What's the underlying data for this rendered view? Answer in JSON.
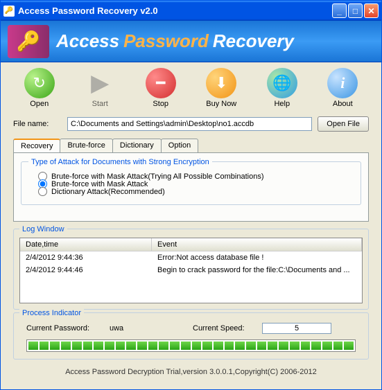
{
  "title": "Access Password Recovery v2.0",
  "banner": {
    "word1": "Access",
    "word2": "Password",
    "word3": "Recovery"
  },
  "toolbar": {
    "open": "Open",
    "start": "Start",
    "stop": "Stop",
    "buy": "Buy Now",
    "help": "Help",
    "about": "About"
  },
  "file": {
    "label": "File name:",
    "value": "C:\\Documents and Settings\\admin\\Desktop\\no1.accdb",
    "open_btn": "Open File"
  },
  "tabs": {
    "recovery": "Recovery",
    "brute": "Brute-force",
    "dict": "Dictionary",
    "option": "Option"
  },
  "attack": {
    "title": "Type of Attack for Documents with Strong Encryption",
    "opt1": "Brute-force with Mask Attack(Trying All Possible Combinations)",
    "opt2": "Brute-force with Mask Attack",
    "opt3": "Dictionary Attack(Recommended)"
  },
  "log": {
    "title": "Log Window",
    "col_date": "Date,time",
    "col_event": "Event",
    "rows": [
      {
        "date": "2/4/2012 9:44:36",
        "event": "Error:Not access database file !"
      },
      {
        "date": "2/4/2012 9:44:46",
        "event": "Begin to crack password for the file:C:\\Documents and ..."
      }
    ]
  },
  "process": {
    "title": "Process Indicator",
    "pwd_label": "Current Password:",
    "pwd_value": "uwa",
    "speed_label": "Current Speed:",
    "speed_value": "5"
  },
  "footer": "Access Password Decryption Trial,version 3.0.0.1,Copyright(C) 2006-2012"
}
